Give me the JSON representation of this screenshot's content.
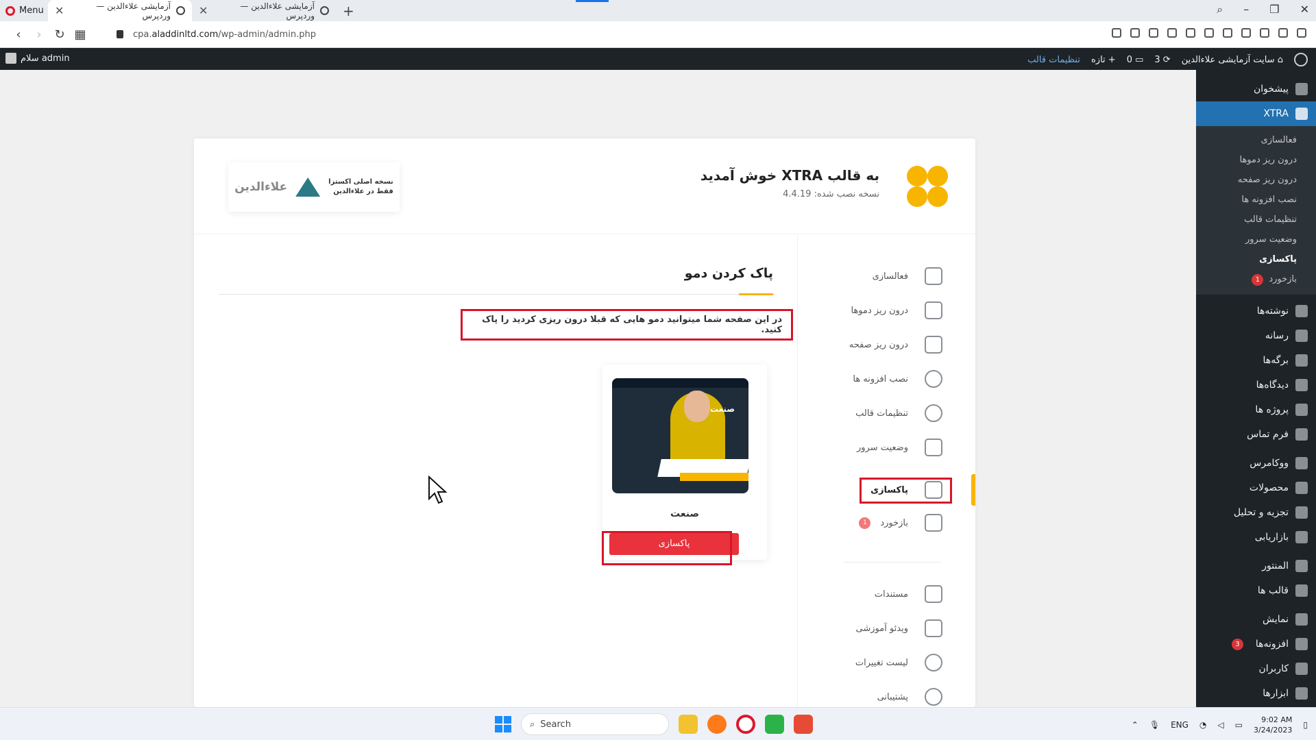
{
  "browser": {
    "menu_label": "Menu",
    "tabs": [
      {
        "title": "آزمایشی علاءالدین — وردپرس",
        "active": true
      },
      {
        "title": "آزمایشی علاءالدین — وردپرس",
        "active": false
      }
    ],
    "url_prefix": "cpa.",
    "url_domain": "aladdinltd.com",
    "url_path": "/wp-admin/admin.php"
  },
  "adminbar": {
    "greeting": "سلام admin",
    "site_name": "سایت آزمایشی علاءالدین",
    "updates_count": "3",
    "comments_count": "0",
    "new_label": "تازه",
    "theme_settings": "تنظیمات قالب"
  },
  "adminmenu": {
    "dashboard": "پیشخوان",
    "xtra": "XTRA",
    "xtra_sub": [
      "فعالسازی",
      "درون ریز دموها",
      "درون ریز صفحه",
      "نصب افزونه ها",
      "تنظیمات قالب",
      "وضعیت سرور",
      "پاکسازی",
      "بازخورد"
    ],
    "feedback_badge": "1",
    "items": [
      "نوشته‌ها",
      "رسانه",
      "برگه‌ها",
      "دیدگاه‌ها",
      "پروژه ها",
      "فرم تماس",
      "ووکامرس",
      "محصولات",
      "تجزیه و تحلیل",
      "بازاریابی",
      "المنتور",
      "قالب ها",
      "نمایش",
      "افزونه‌ها",
      "کاربران",
      "ابزارها"
    ],
    "plugins_badge": "3"
  },
  "header": {
    "welcome": "به قالب XTRA خوش آمدید",
    "version": "نسخه نصب شده: 4.4.19",
    "partner_line1": "نسخه اصلی اکستزا",
    "partner_line2": "فقط در علاءالدین",
    "partner_name": "علاءالدین"
  },
  "side_nav": {
    "items": [
      "فعالسازی",
      "درون ریز دموها",
      "درون ریز صفحه",
      "نصب افزونه ها",
      "تنظیمات قالب",
      "وضعیت سرور",
      "پاکسازی",
      "بازخورد"
    ],
    "feedback_badge": "1",
    "extra": [
      "مستندات",
      "ویدئو آموزشی",
      "لیست تغییرات",
      "پشتیبانی"
    ]
  },
  "content": {
    "title": "پاک کردن دمو",
    "description": "در این صفحه شما میتوانید دمو هایی که قبلا درون ریزی کردید را پاک کنید.",
    "demo": {
      "name": "صنعت",
      "thumb_title": "صنعت",
      "button": "پاکسازی"
    }
  },
  "taskbar": {
    "search_placeholder": "Search",
    "lang": "ENG",
    "time": "9:02 AM",
    "date": "3/24/2023"
  },
  "colors": {
    "accent_yellow": "#f7b500",
    "wp_dark": "#1d2327",
    "wp_blue": "#2271b1",
    "danger": "#e9323c",
    "highlight_box": "#d7152a"
  }
}
